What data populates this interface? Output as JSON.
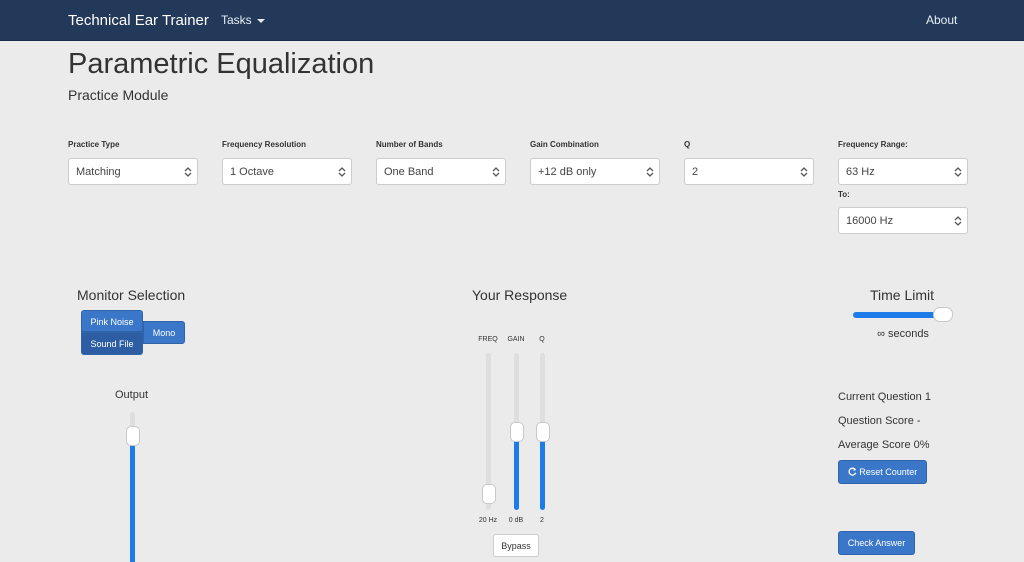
{
  "navbar": {
    "brand": "Technical Ear Trainer",
    "tasks_label": "Tasks",
    "about_label": "About"
  },
  "page": {
    "title": "Parametric Equalization",
    "subtitle": "Practice Module"
  },
  "controls": {
    "practice_type": {
      "label": "Practice Type",
      "value": "Matching"
    },
    "frequency_resolution": {
      "label": "Frequency Resolution",
      "value": "1 Octave"
    },
    "number_of_bands": {
      "label": "Number of Bands",
      "value": "One Band"
    },
    "gain_combination": {
      "label": "Gain Combination",
      "value": "+12 dB only"
    },
    "q": {
      "label": "Q",
      "value": "2"
    },
    "frequency_range": {
      "label": "Frequency Range:",
      "from_value": "63 Hz",
      "to_label": "To:",
      "to_value": "16000 Hz"
    }
  },
  "monitor": {
    "title": "Monitor Selection",
    "pink_noise_label": "Pink Noise",
    "sound_file_label": "Sound File",
    "mono_label": "Mono",
    "selected": "Sound File",
    "output_title": "Output",
    "output_level": 0.9
  },
  "response": {
    "title": "Your Response",
    "sliders": [
      {
        "name": "FREQ",
        "value_label": "20 Hz",
        "level": 0.0
      },
      {
        "name": "GAIN",
        "value_label": "0 dB",
        "level": 0.5
      },
      {
        "name": "Q",
        "value_label": "2",
        "level": 0.5
      }
    ],
    "bypass_label": "Bypass"
  },
  "time_limit": {
    "title": "Time Limit",
    "value_label": "∞ seconds",
    "level": 1.0
  },
  "stats": {
    "current_question": "Current Question 1",
    "question_score": "Question Score -",
    "average_score": "Average Score 0%",
    "reset_label": "Reset Counter",
    "check_label": "Check Answer"
  },
  "colors": {
    "navbar": "#22395a",
    "accent": "#3a77c8",
    "slider_fill": "#1d7ce8",
    "background": "#ebebeb"
  }
}
